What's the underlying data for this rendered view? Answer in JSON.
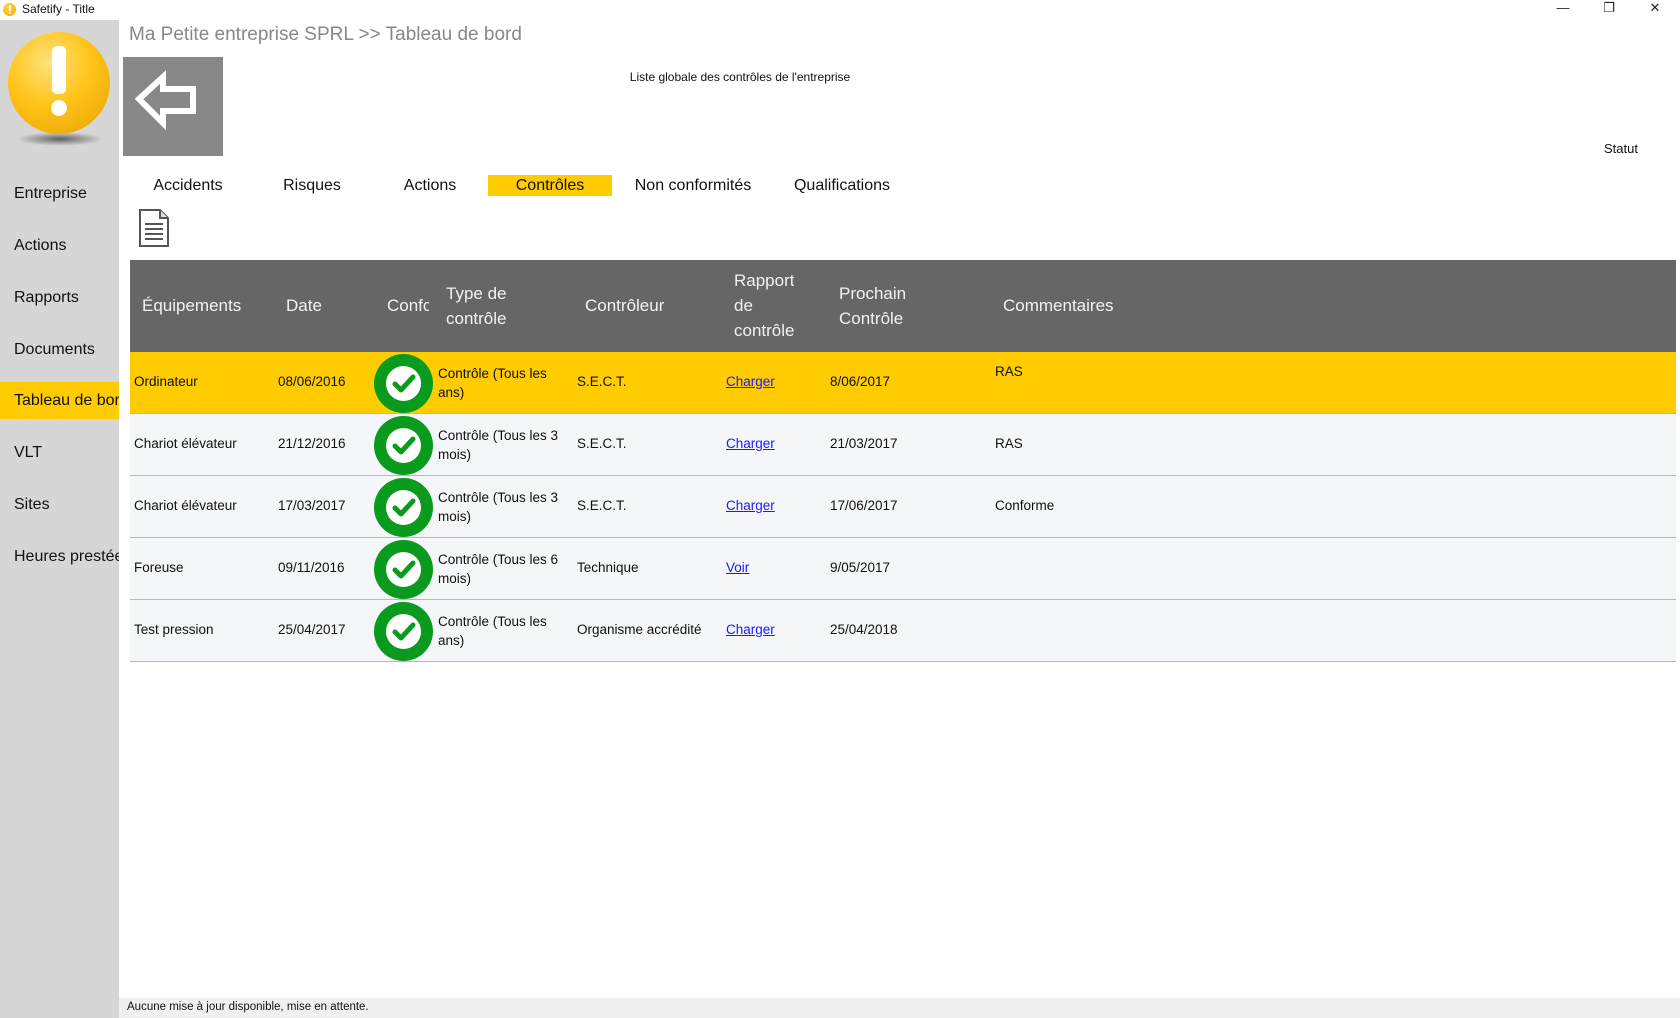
{
  "window": {
    "title": "Safetify - Title",
    "minimize": "—",
    "maximize": "❐",
    "close": "✕"
  },
  "sidebar": {
    "items": [
      {
        "label": "Entreprise"
      },
      {
        "label": "Actions"
      },
      {
        "label": "Rapports"
      },
      {
        "label": "Documents"
      },
      {
        "label": "Tableau de bord",
        "active": true
      },
      {
        "label": "VLT"
      },
      {
        "label": "Sites"
      },
      {
        "label": "Heures prestées"
      }
    ]
  },
  "header": {
    "breadcrumb": "Ma Petite entreprise SPRL >> Tableau de bord",
    "list_title": "Liste globale des contrôles de l'entreprise",
    "statut_label": "Statut"
  },
  "tabs": [
    {
      "label": "Accidents"
    },
    {
      "label": "Risques"
    },
    {
      "label": "Actions"
    },
    {
      "label": "Contrôles",
      "active": true
    },
    {
      "label": "Non conformités"
    },
    {
      "label": "Qualifications"
    }
  ],
  "table": {
    "columns": [
      {
        "label": "Équipements"
      },
      {
        "label": "Date"
      },
      {
        "label": "Confo"
      },
      {
        "label": "Type de contrôle",
        "lines": [
          "Type de",
          "contrôle"
        ]
      },
      {
        "label": "Contrôleur"
      },
      {
        "label": "Rapport de contrôle",
        "lines": [
          "Rapport",
          "de",
          "contrôle"
        ]
      },
      {
        "label": "Prochain Contrôle",
        "lines": [
          "Prochain",
          "Contrôle"
        ]
      },
      {
        "label": "Commentaires"
      }
    ],
    "rows": [
      {
        "equipement": "Ordinateur",
        "date": "08/06/2016",
        "conforme": true,
        "type": "Contrôle (Tous les ans)",
        "controleur": "S.E.C.T.",
        "rapport": "Charger",
        "prochain": "8/06/2017",
        "commentaires": "RAS",
        "selected": true
      },
      {
        "equipement": "Chariot élévateur",
        "date": "21/12/2016",
        "conforme": true,
        "type": "Contrôle (Tous les 3 mois)",
        "controleur": "S.E.C.T.",
        "rapport": "Charger",
        "prochain": "21/03/2017",
        "commentaires": "RAS"
      },
      {
        "equipement": "Chariot élévateur",
        "date": "17/03/2017",
        "conforme": true,
        "type": "Contrôle (Tous les 3 mois)",
        "controleur": "S.E.C.T.",
        "rapport": "Charger",
        "prochain": "17/06/2017",
        "commentaires": "Conforme"
      },
      {
        "equipement": "Foreuse",
        "date": "09/11/2016",
        "conforme": true,
        "type": "Contrôle (Tous les 6 mois)",
        "controleur": "Technique",
        "rapport": "Voir",
        "prochain": "9/05/2017",
        "commentaires": ""
      },
      {
        "equipement": "Test pression",
        "date": "25/04/2017",
        "conforme": true,
        "type": "Contrôle (Tous les ans)",
        "controleur": "Organisme accrédité",
        "rapport": "Charger",
        "prochain": "25/04/2018",
        "commentaires": ""
      }
    ]
  },
  "statusbar": {
    "text": "Aucune mise à jour disponible, mise en attente."
  },
  "colors": {
    "accent": "#ffcc00",
    "sidebar_bg": "#d6d6d6",
    "header_bg": "#666666",
    "status_ok": "#0a9a1e",
    "link": "#1a1aff"
  }
}
